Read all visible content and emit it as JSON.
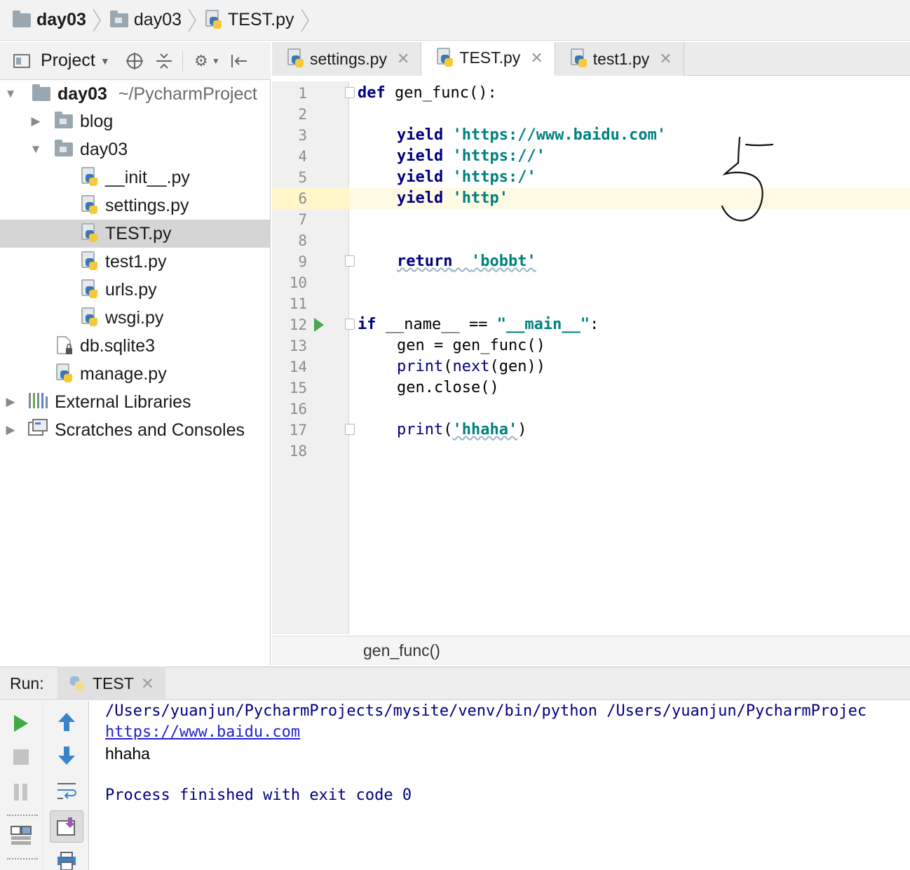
{
  "breadcrumb": {
    "items": [
      "day03",
      "day03",
      "TEST.py"
    ]
  },
  "project_panel": {
    "title": "Project",
    "tree": {
      "root_name": "day03",
      "root_path": "~/PycharmProject",
      "folder_blog": "blog",
      "folder_day03": "day03",
      "files": [
        "__init__.py",
        "settings.py",
        "TEST.py",
        "test1.py",
        "urls.py",
        "wsgi.py"
      ],
      "db_file": "db.sqlite3",
      "manage_file": "manage.py",
      "external_libraries": "External Libraries",
      "scratches": "Scratches and Consoles"
    }
  },
  "editor": {
    "tabs": [
      {
        "label": "settings.py",
        "active": false
      },
      {
        "label": "TEST.py",
        "active": true
      },
      {
        "label": "test1.py",
        "active": false
      }
    ],
    "line_numbers": [
      "1",
      "2",
      "3",
      "4",
      "5",
      "6",
      "7",
      "8",
      "9",
      "10",
      "11",
      "12",
      "13",
      "14",
      "15",
      "16",
      "17",
      "18"
    ],
    "code": {
      "l1_kw": "def",
      "l1_rest": " gen_func():",
      "yield_kw": "yield",
      "l3_str": "'https://www.baidu.com'",
      "l4_str": "'https://'",
      "l5_str": "'https:/'",
      "l6_str": "'http'",
      "l9_kw": "return",
      "l9_str": "'bobbt'",
      "l12_kw": "if",
      "l12_mid": " __name__ == ",
      "l12_str": "\"__main__\"",
      "l12_end": ":",
      "l13": "gen = gen_func()",
      "l14_print": "print",
      "l14_open": "(",
      "l14_next": "next",
      "l14_rest": "(gen))",
      "l15": "gen.close()",
      "l17_print": "print",
      "l17_open": "(",
      "l17_str": "'hhaha'",
      "l17_close": ")"
    },
    "handwritten_annotation": "5",
    "footer_crumb": "gen_func()",
    "current_line": 6
  },
  "run_panel": {
    "label": "Run:",
    "tab_label": "TEST",
    "console": {
      "command": "/Users/yuanjun/PycharmProjects/mysite/venv/bin/python /Users/yuanjun/PycharmProjec",
      "link": "https://www.baidu.com",
      "output": "hhaha",
      "exit_message": "Process finished with exit code 0"
    }
  },
  "colors": {
    "keyword": "#000080",
    "string": "#008080",
    "run_green": "#4ca850",
    "current_line": "#fffae3"
  }
}
